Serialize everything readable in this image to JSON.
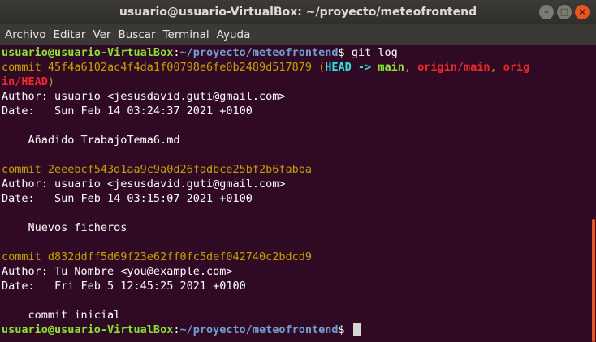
{
  "window": {
    "title": "usuario@usuario-VirtualBox: ~/proyecto/meteofrontend",
    "minimize": "–",
    "maximize": "□",
    "close": "×"
  },
  "menu": [
    "Archivo",
    "Editar",
    "Ver",
    "Buscar",
    "Terminal",
    "Ayuda"
  ],
  "prompt": {
    "user_host": "usuario@usuario-VirtualBox",
    "separator": ":",
    "path": "~/proyecto/meteofrontend",
    "symbol": "$ ",
    "command": "git log"
  },
  "commits": [
    {
      "hash_line": "commit 45f4a6102ac4f4da1f00798e6fe0b2489d517879",
      "refs": {
        "open": " (",
        "head": "HEAD -> ",
        "branch": "main",
        "sep1": ", ",
        "origin_main": "origin/main",
        "sep2": ", ",
        "origin_head_part1": "orig",
        "origin_head_part2": "in/HEAD",
        "close": ")"
      },
      "author": "Author: usuario <jesusdavid.guti@gmail.com>",
      "date": "Date:   Sun Feb 14 03:24:37 2021 +0100",
      "message": "    Añadido TrabajoTema6.md"
    },
    {
      "hash_line": "commit 2eeebcf543d1aa9c9a0d26fadbce25bf2b6fabba",
      "author": "Author: usuario <jesusdavid.guti@gmail.com>",
      "date": "Date:   Sun Feb 14 03:15:07 2021 +0100",
      "message": "    Nuevos ficheros"
    },
    {
      "hash_line": "commit d832ddff5d69f23e62ff0fc5def042740c2bdcd9",
      "author": "Author: Tu Nombre <you@example.com>",
      "date": "Date:   Fri Feb 5 12:45:25 2021 +0100",
      "message": "    commit inicial"
    }
  ],
  "colors": {
    "background": "#300a24",
    "prompt_user": "#8ae234",
    "prompt_path": "#729fcf",
    "commit_hash": "#c4a000",
    "ref_head": "#34e2e2",
    "ref_branch": "#8ae234",
    "ref_remote": "#ef2929",
    "scroll_thumb": "#e95420"
  }
}
